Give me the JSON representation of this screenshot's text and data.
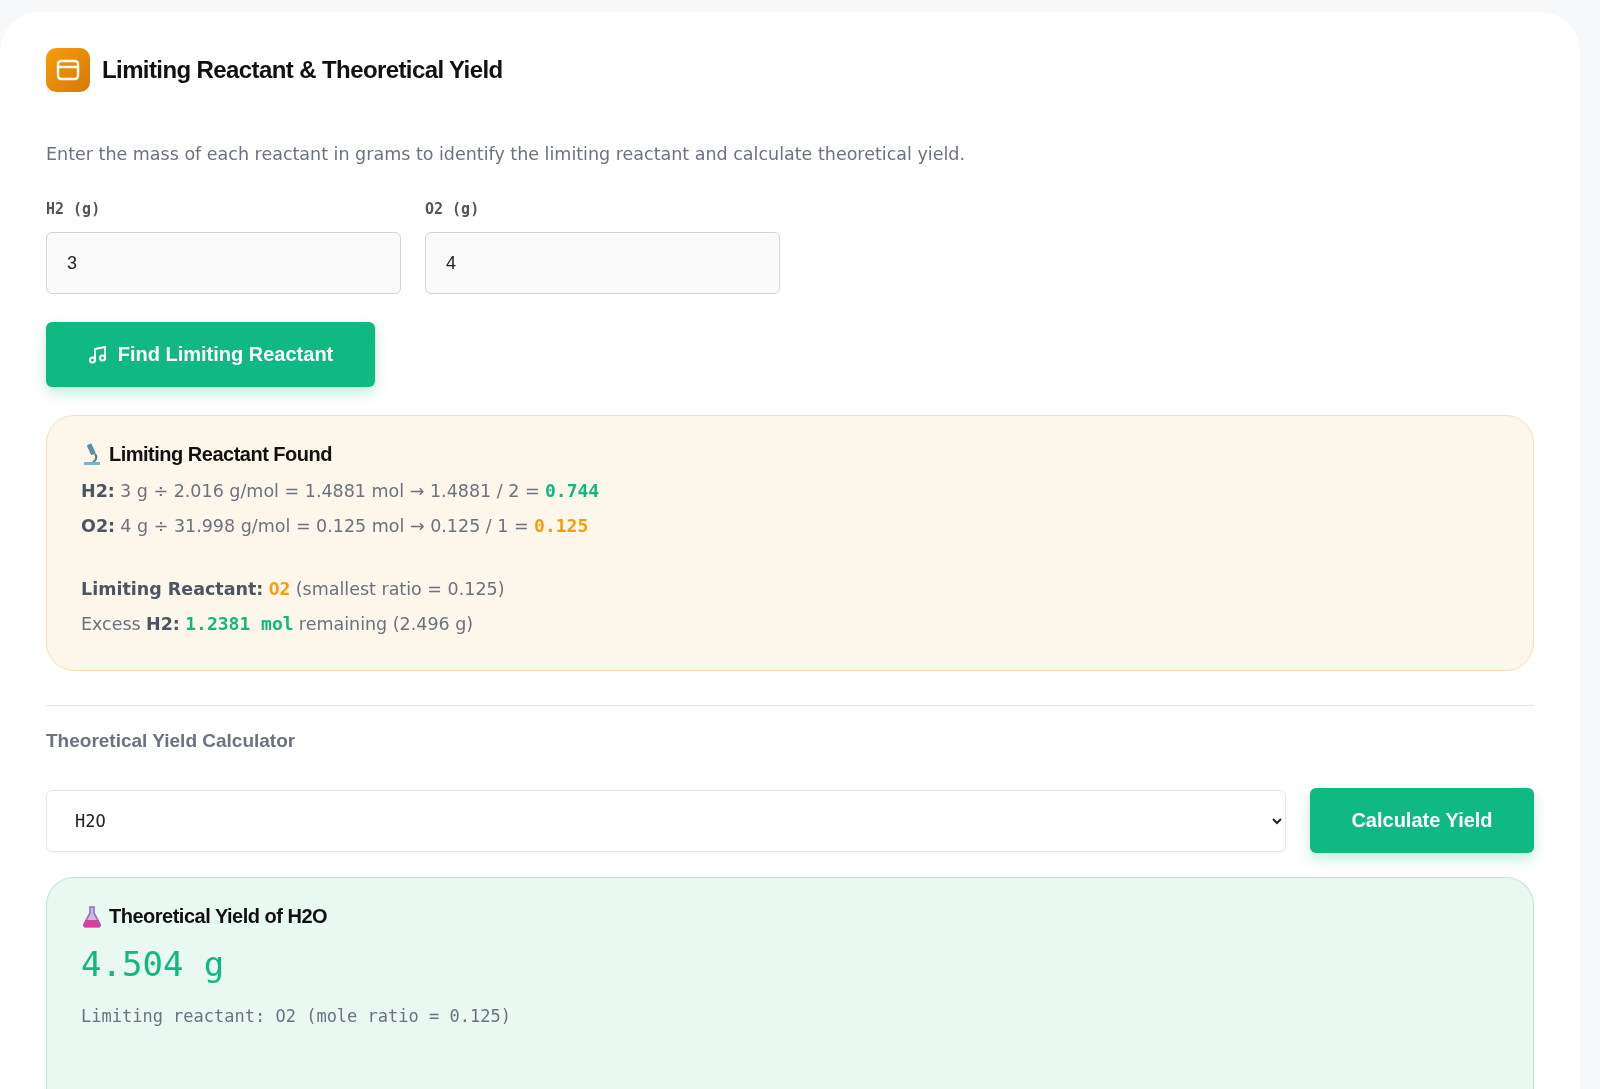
{
  "header": {
    "title": "Limiting Reactant & Theoretical Yield"
  },
  "description": "Enter the mass of each reactant in grams to identify the limiting reactant and calculate theoretical yield.",
  "inputs": [
    {
      "label": "H2 (g)",
      "value": "3"
    },
    {
      "label": "O2 (g)",
      "value": "4"
    }
  ],
  "find_button": "Find Limiting Reactant",
  "limiting_result": {
    "title": "Limiting Reactant Found",
    "ratio_lines": [
      {
        "segments": [
          {
            "kind": "bold",
            "text": "H2:"
          },
          {
            "kind": "plain",
            "text": "3 g ÷ 2.016 g/mol = 1.4881 mol → 1.4881 / 2 ="
          },
          {
            "kind": "value",
            "text": "0.744",
            "color": "#10b981"
          }
        ]
      },
      {
        "segments": [
          {
            "kind": "bold",
            "text": "O2:"
          },
          {
            "kind": "plain",
            "text": "4 g ÷ 31.998 g/mol = 0.125 mol → 0.125 / 1 ="
          },
          {
            "kind": "value",
            "text": "0.125",
            "color": "#f59e0b"
          }
        ]
      }
    ],
    "summary_lines": [
      {
        "segments": [
          {
            "kind": "bold",
            "text": "Limiting Reactant:"
          },
          {
            "kind": "value",
            "text": "O2",
            "color": "#f59e0b"
          },
          {
            "kind": "plain",
            "text": "(smallest ratio = 0.125)"
          }
        ]
      },
      {
        "segments": [
          {
            "kind": "plain",
            "text": "Excess"
          },
          {
            "kind": "bold",
            "text": "H2:"
          },
          {
            "kind": "value",
            "text": "1.2381 mol",
            "color": "#10b981"
          },
          {
            "kind": "plain",
            "text": "remaining (2.496 g)"
          }
        ]
      }
    ]
  },
  "yield_section": {
    "title": "Theoretical Yield Calculator",
    "product_select": {
      "value": "H2O"
    },
    "button": "Calculate Yield"
  },
  "yield_result": {
    "title": "Theoretical Yield of H2O",
    "amount": "4.504 g",
    "note": "Limiting reactant: O2 (mole ratio = 0.125)"
  }
}
